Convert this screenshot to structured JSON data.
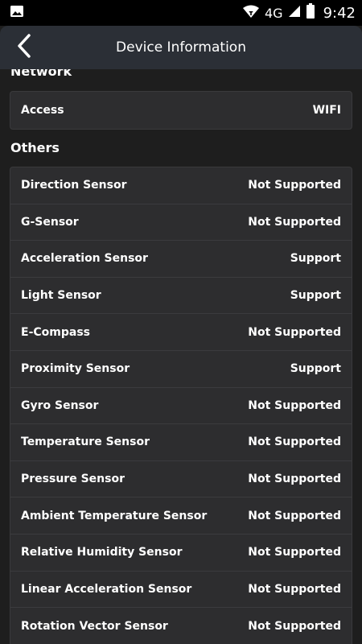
{
  "status_bar": {
    "network_type": "4G",
    "time": "9:42"
  },
  "header": {
    "title": "Device Information"
  },
  "network_section": {
    "title": "Network",
    "items": [
      {
        "label": "Access",
        "value": "WIFI"
      }
    ]
  },
  "others_section": {
    "title": "Others",
    "items": [
      {
        "label": "Direction Sensor",
        "value": "Not Supported"
      },
      {
        "label": "G-Sensor",
        "value": "Not Supported"
      },
      {
        "label": "Acceleration Sensor",
        "value": "Support"
      },
      {
        "label": "Light Sensor",
        "value": "Support"
      },
      {
        "label": "E-Compass",
        "value": "Not Supported"
      },
      {
        "label": "Proximity Sensor",
        "value": "Support"
      },
      {
        "label": "Gyro Sensor",
        "value": "Not Supported"
      },
      {
        "label": "Temperature Sensor",
        "value": "Not Supported"
      },
      {
        "label": "Pressure Sensor",
        "value": "Not Supported"
      },
      {
        "label": "Ambient Temperature Sensor",
        "value": "Not Supported"
      },
      {
        "label": "Relative Humidity Sensor",
        "value": "Not Supported"
      },
      {
        "label": "Linear Acceleration Sensor",
        "value": "Not Supported"
      },
      {
        "label": "Rotation Vector Sensor",
        "value": "Not Supported"
      }
    ]
  }
}
